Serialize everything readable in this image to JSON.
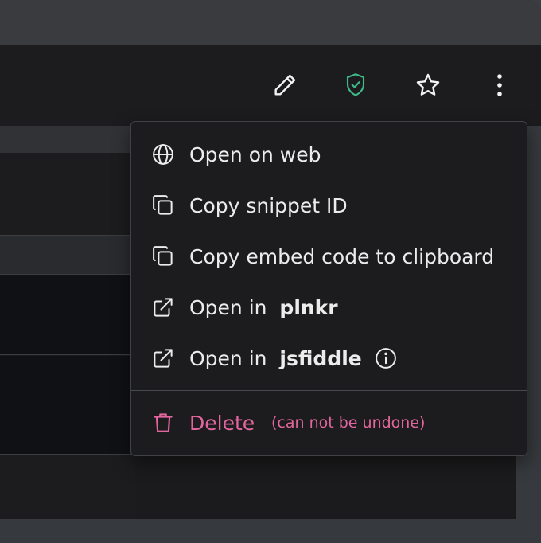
{
  "toolbar": {
    "icons": [
      "pencil-icon",
      "shield-check-icon",
      "star-icon",
      "more-vertical-icon"
    ],
    "shield_color": "#3fb98a"
  },
  "menu": {
    "items": [
      {
        "label": "Open on web",
        "icon": "globe-icon"
      },
      {
        "label": "Copy snippet ID",
        "icon": "copy-icon"
      },
      {
        "label": "Copy embed code to clipboard",
        "icon": "copy-icon"
      },
      {
        "label_prefix": "Open in",
        "label_bold": "plnkr",
        "icon": "external-link-icon"
      },
      {
        "label_prefix": "Open in",
        "label_bold": "jsfiddle",
        "icon": "external-link-icon",
        "trailing_icon": "info-icon"
      }
    ],
    "delete": {
      "label": "Delete",
      "note": "(can not be undone)",
      "icon": "trash-icon",
      "color": "#e2669e"
    }
  }
}
